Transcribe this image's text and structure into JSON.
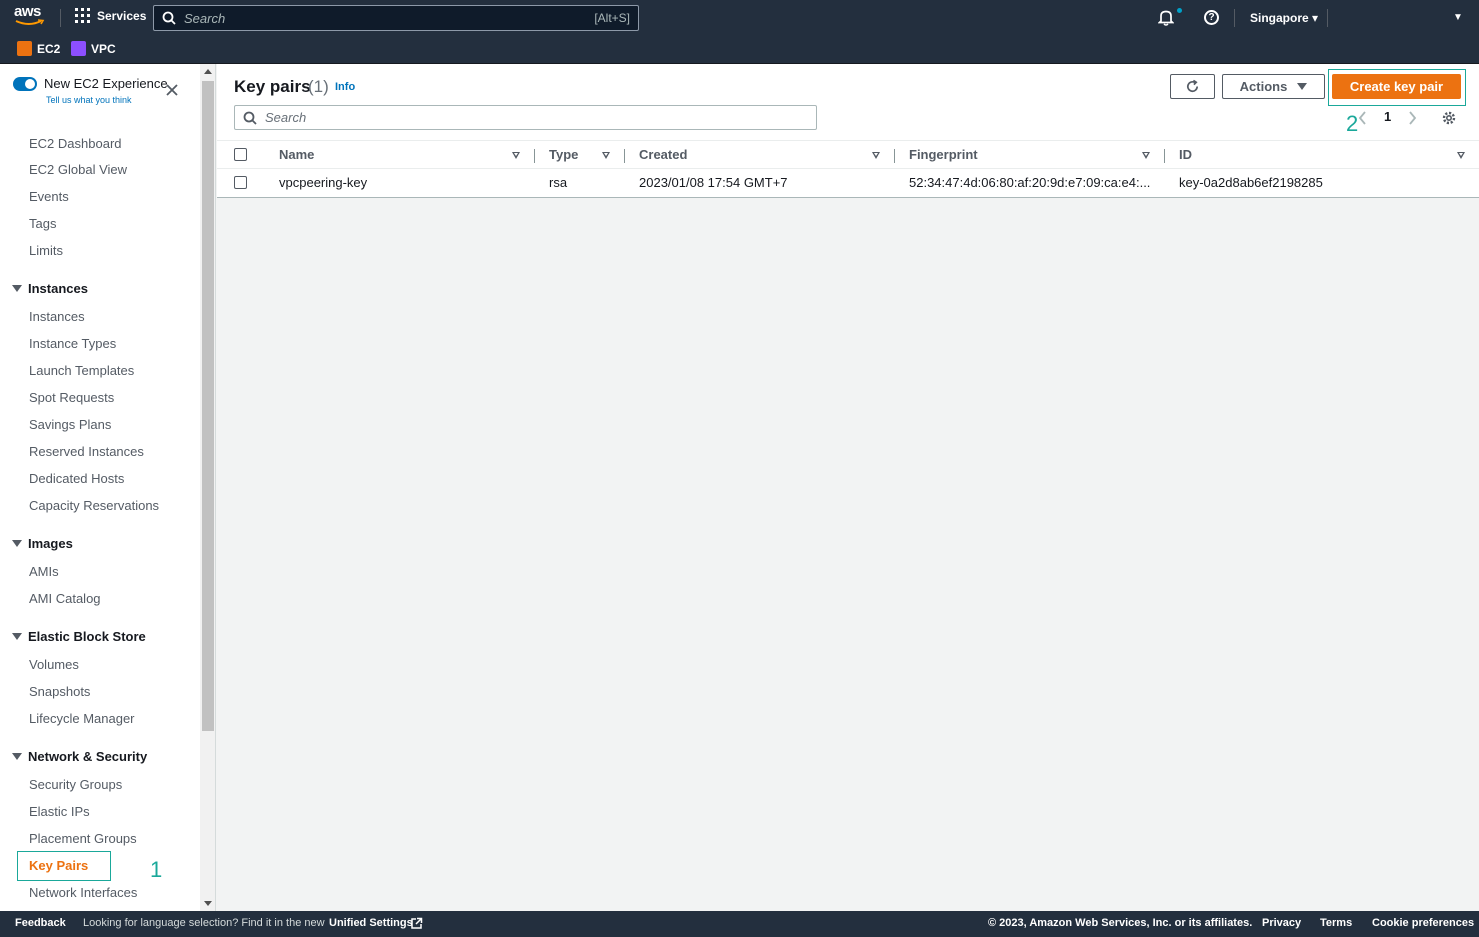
{
  "topnav": {
    "logo_text": "aws",
    "services_label": "Services",
    "search_placeholder": "Search",
    "search_shortcut": "[Alt+S]",
    "region": "Singapore ▾",
    "account_caret": "▼"
  },
  "favorites": [
    {
      "label": "EC2",
      "color": "#ec7211"
    },
    {
      "label": "VPC",
      "color": "#8c4fff"
    }
  ],
  "sidebar": {
    "new_experience": "New EC2 Experience",
    "tell_us": "Tell us what you think",
    "top_items": [
      "EC2 Dashboard",
      "EC2 Global View",
      "Events",
      "Tags",
      "Limits"
    ],
    "sections": [
      {
        "title": "Instances",
        "items": [
          "Instances",
          "Instance Types",
          "Launch Templates",
          "Spot Requests",
          "Savings Plans",
          "Reserved Instances",
          "Dedicated Hosts",
          "Capacity Reservations"
        ]
      },
      {
        "title": "Images",
        "items": [
          "AMIs",
          "AMI Catalog"
        ]
      },
      {
        "title": "Elastic Block Store",
        "items": [
          "Volumes",
          "Snapshots",
          "Lifecycle Manager"
        ]
      },
      {
        "title": "Network & Security",
        "items": [
          "Security Groups",
          "Elastic IPs",
          "Placement Groups",
          "Key Pairs",
          "Network Interfaces"
        ]
      }
    ],
    "active_item": "Key Pairs",
    "annotation": "1"
  },
  "panel": {
    "title": "Key pairs",
    "count": "(1)",
    "info": "Info",
    "actions_label": "Actions",
    "create_label": "Create key pair",
    "search_placeholder": "Search",
    "page": "1",
    "annotation": "2"
  },
  "table": {
    "columns": [
      "Name",
      "Type",
      "Created",
      "Fingerprint",
      "ID"
    ],
    "rows": [
      {
        "name": "vpcpeering-key",
        "type": "rsa",
        "created": "2023/01/08 17:54 GMT+7",
        "fingerprint": "52:34:47:4d:06:80:af:20:9d:e7:09:ca:e4:...",
        "id": "key-0a2d8ab6ef2198285"
      }
    ]
  },
  "footer": {
    "feedback": "Feedback",
    "language_note": "Looking for language selection? Find it in the new",
    "unified_settings": "Unified Settings",
    "copyright": "© 2023, Amazon Web Services, Inc. or its affiliates.",
    "privacy": "Privacy",
    "terms": "Terms",
    "cookie": "Cookie preferences"
  }
}
